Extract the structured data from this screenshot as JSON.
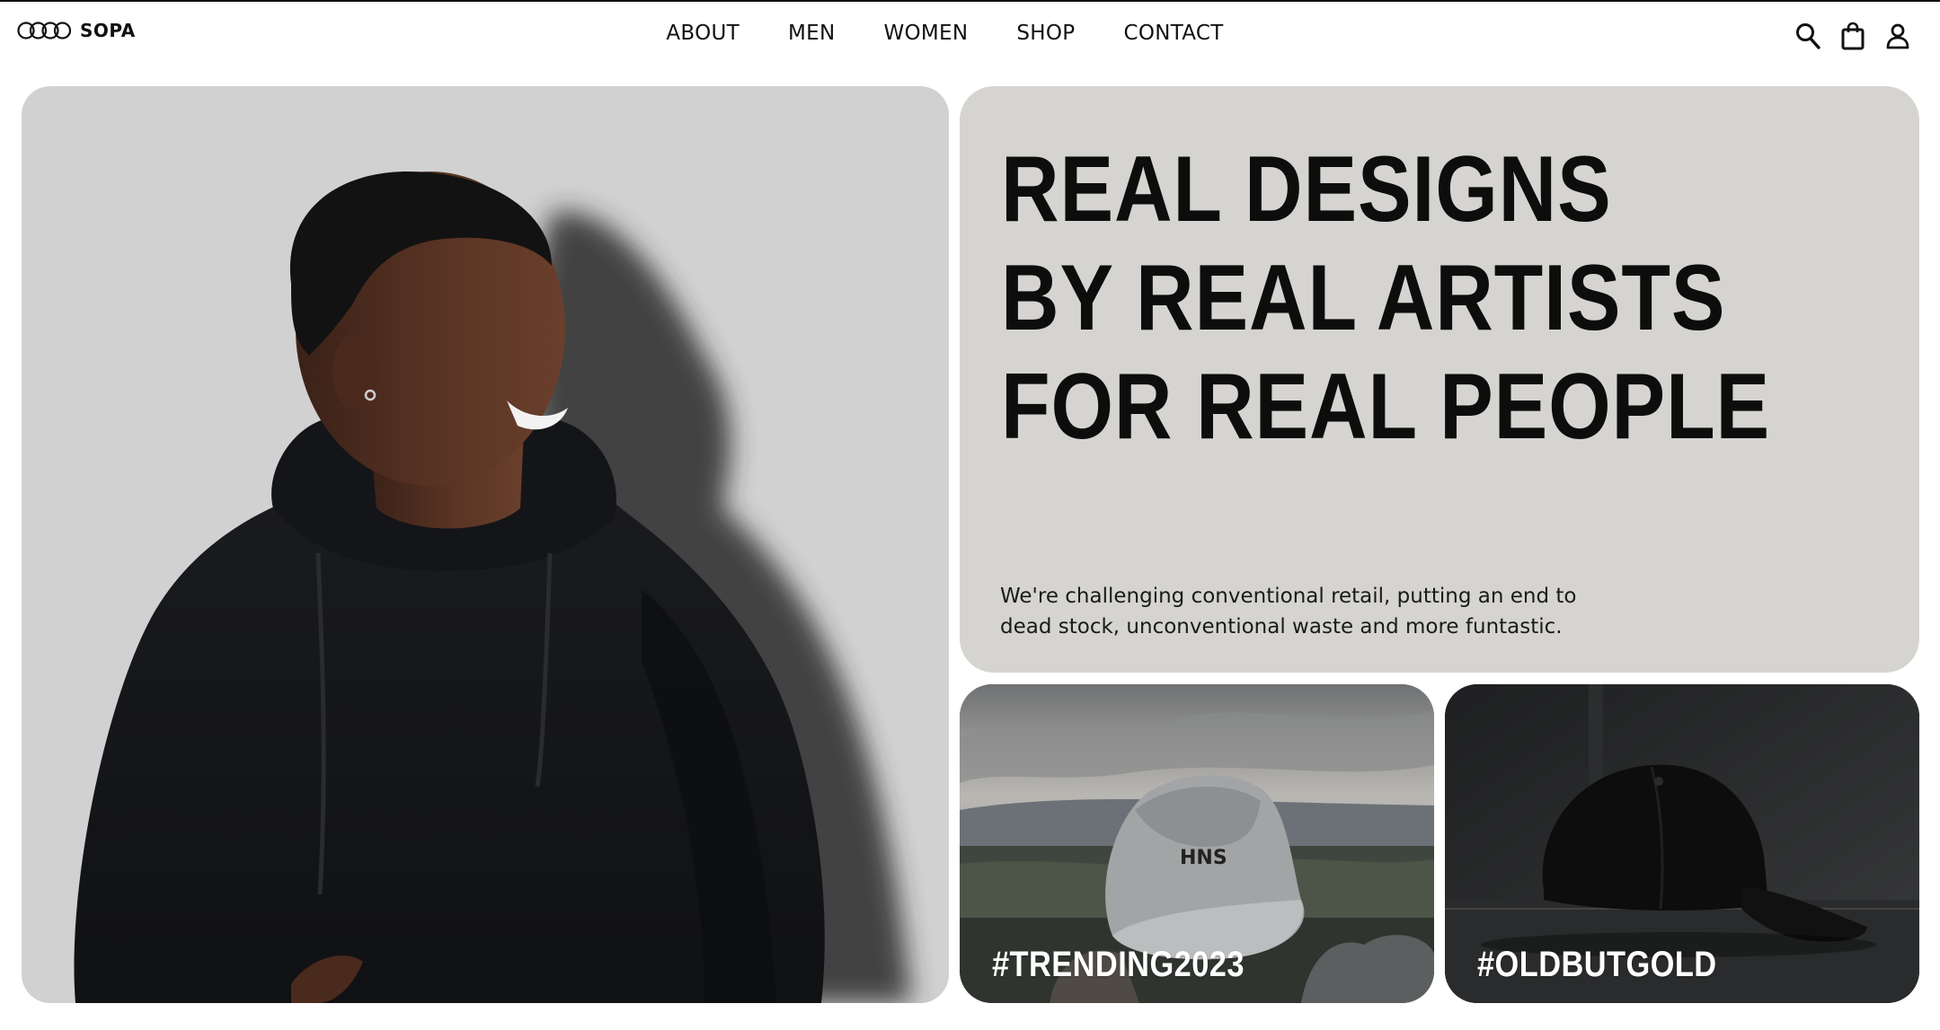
{
  "brand": {
    "name": "SOPA",
    "logo_icon": "four-rings-logo"
  },
  "nav": {
    "items": [
      {
        "label": "ABOUT"
      },
      {
        "label": "MEN"
      },
      {
        "label": "WOMEN"
      },
      {
        "label": "SHOP"
      },
      {
        "label": "CONTACT"
      }
    ]
  },
  "header_icons": [
    "search-icon",
    "shopping-bag-icon",
    "user-icon"
  ],
  "hero": {
    "headline": [
      "REAL DESIGNS",
      "BY REAL ARTISTS",
      "FOR REAL PEOPLE"
    ],
    "subcopy_lines": [
      "We're challenging conventional retail, putting an end to",
      "dead stock, unconventional waste and more funtastic."
    ]
  },
  "promos": [
    {
      "label": "#TRENDING2023"
    },
    {
      "label": "#OLDBUTGOLD"
    }
  ],
  "colors": {
    "text": "#111111",
    "hero_bg": "#d1d1d1",
    "text_card_bg": "#d5d4d1",
    "promo_label": "#ffffff"
  }
}
